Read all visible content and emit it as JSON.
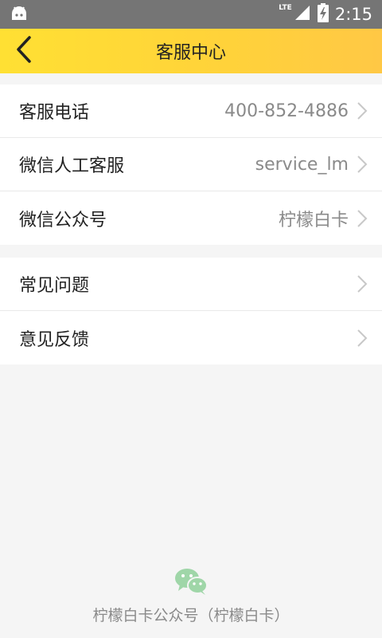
{
  "status_bar": {
    "network": "LTE",
    "time": "2:15"
  },
  "header": {
    "title": "客服中心"
  },
  "groups": [
    {
      "items": [
        {
          "label": "客服电话",
          "value": "400-852-4886"
        },
        {
          "label": "微信人工客服",
          "value": "service_lm"
        },
        {
          "label": "微信公众号",
          "value": "柠檬白卡"
        }
      ]
    },
    {
      "items": [
        {
          "label": "常见问题",
          "value": ""
        },
        {
          "label": "意见反馈",
          "value": ""
        }
      ]
    }
  ],
  "footer": {
    "text": "柠檬白卡公众号（柠檬白卡）",
    "icon": "wechat-icon"
  },
  "colors": {
    "header_start": "#ffe033",
    "header_end": "#ffc845",
    "wechat_green": "#9fd6a8"
  }
}
